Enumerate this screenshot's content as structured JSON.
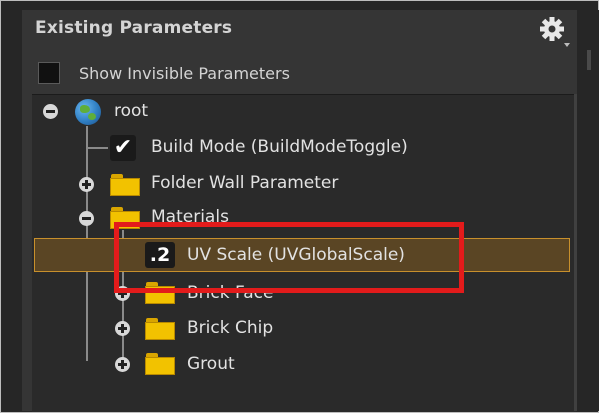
{
  "panel": {
    "title": "Existing Parameters",
    "settings_icon": "gear-icon",
    "show_invisible_label": "Show Invisible Parameters",
    "show_invisible_checked": false
  },
  "tree": {
    "root_label": "root",
    "root_icon": "globe-icon",
    "items": [
      {
        "label": "Build Mode (BuildModeToggle)",
        "icon": "checkmark-icon",
        "glyph": "✔"
      },
      {
        "label": "Folder Wall Parameter",
        "icon": "folder-icon"
      },
      {
        "label": "Materials",
        "icon": "folder-icon"
      },
      {
        "label": "UV Scale (UVGlobalScale)",
        "icon": "float-parameter-icon",
        "glyph": ".2"
      },
      {
        "label": "Brick Face",
        "icon": "folder-icon"
      },
      {
        "label": "Brick Chip",
        "icon": "folder-icon"
      },
      {
        "label": "Grout",
        "icon": "folder-icon"
      }
    ],
    "selected_item": "UV Scale (UVGlobalScale)"
  },
  "colors": {
    "highlight_box": "#e31b1b",
    "selection": "#c8902c",
    "folder": "#f2c200"
  }
}
